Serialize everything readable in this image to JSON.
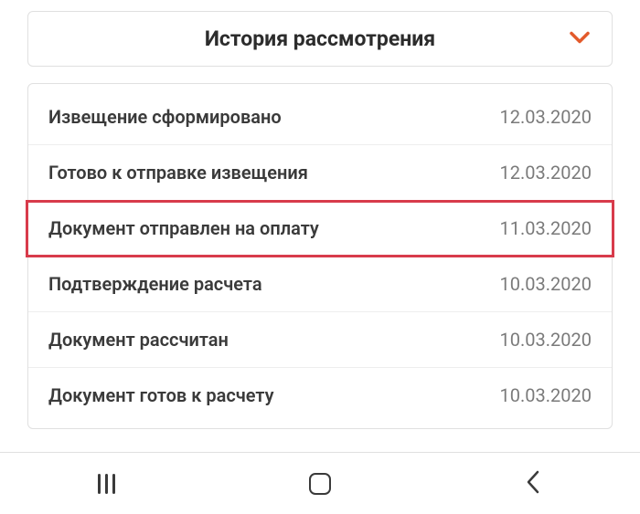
{
  "header": {
    "title": "История рассмотрения"
  },
  "history": {
    "items": [
      {
        "label": "Извещение сформировано",
        "date": "12.03.2020",
        "highlighted": false
      },
      {
        "label": "Готово к отправке извещения",
        "date": "12.03.2020",
        "highlighted": false
      },
      {
        "label": "Документ отправлен на оплату",
        "date": "11.03.2020",
        "highlighted": true
      },
      {
        "label": "Подтверждение расчета",
        "date": "10.03.2020",
        "highlighted": false
      },
      {
        "label": "Документ рассчитан",
        "date": "10.03.2020",
        "highlighted": false
      },
      {
        "label": "Документ готов к расчету",
        "date": "10.03.2020",
        "highlighted": false
      }
    ]
  },
  "colors": {
    "accent": "#e35a2b",
    "highlight": "#d83b4b"
  }
}
